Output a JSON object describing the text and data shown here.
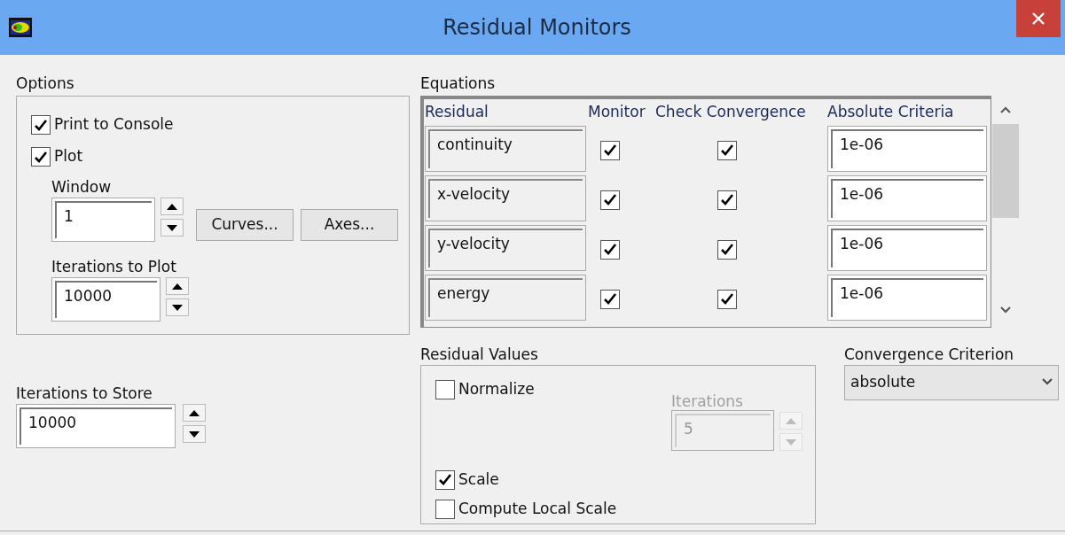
{
  "window": {
    "title": "Residual Monitors"
  },
  "options": {
    "label": "Options",
    "checkboxes": [
      {
        "label": "Print to Console",
        "checked": true
      },
      {
        "label": "Plot",
        "checked": true
      }
    ],
    "window_field": {
      "label": "Window",
      "value": "1"
    },
    "buttons": [
      "Curves...",
      "Axes..."
    ],
    "iterations_to_plot": {
      "label": "Iterations to Plot",
      "value": "10000"
    }
  },
  "iterations_to_store": {
    "label": "Iterations to Store",
    "value": "10000"
  },
  "equations": {
    "label": "Equations",
    "columns": [
      "Residual",
      "Monitor",
      "Check Convergence",
      "Absolute Criteria"
    ],
    "rows": [
      {
        "residual": "continuity",
        "monitor": true,
        "check_convergence": true,
        "absolute_criteria": "1e-06"
      },
      {
        "residual": "x-velocity",
        "monitor": true,
        "check_convergence": true,
        "absolute_criteria": "1e-06"
      },
      {
        "residual": "y-velocity",
        "monitor": true,
        "check_convergence": true,
        "absolute_criteria": "1e-06"
      },
      {
        "residual": "energy",
        "monitor": true,
        "check_convergence": true,
        "absolute_criteria": "1e-06"
      }
    ]
  },
  "residual_values": {
    "label": "Residual Values",
    "normalize": {
      "label": "Normalize",
      "checked": false
    },
    "iterations": {
      "label": "Iterations",
      "value": "5",
      "disabled": true
    },
    "scale": {
      "label": "Scale",
      "checked": true
    },
    "compute_local_scale": {
      "label": "Compute Local Scale",
      "checked": false
    }
  },
  "convergence_criterion": {
    "label": "Convergence Criterion",
    "value": "absolute"
  }
}
